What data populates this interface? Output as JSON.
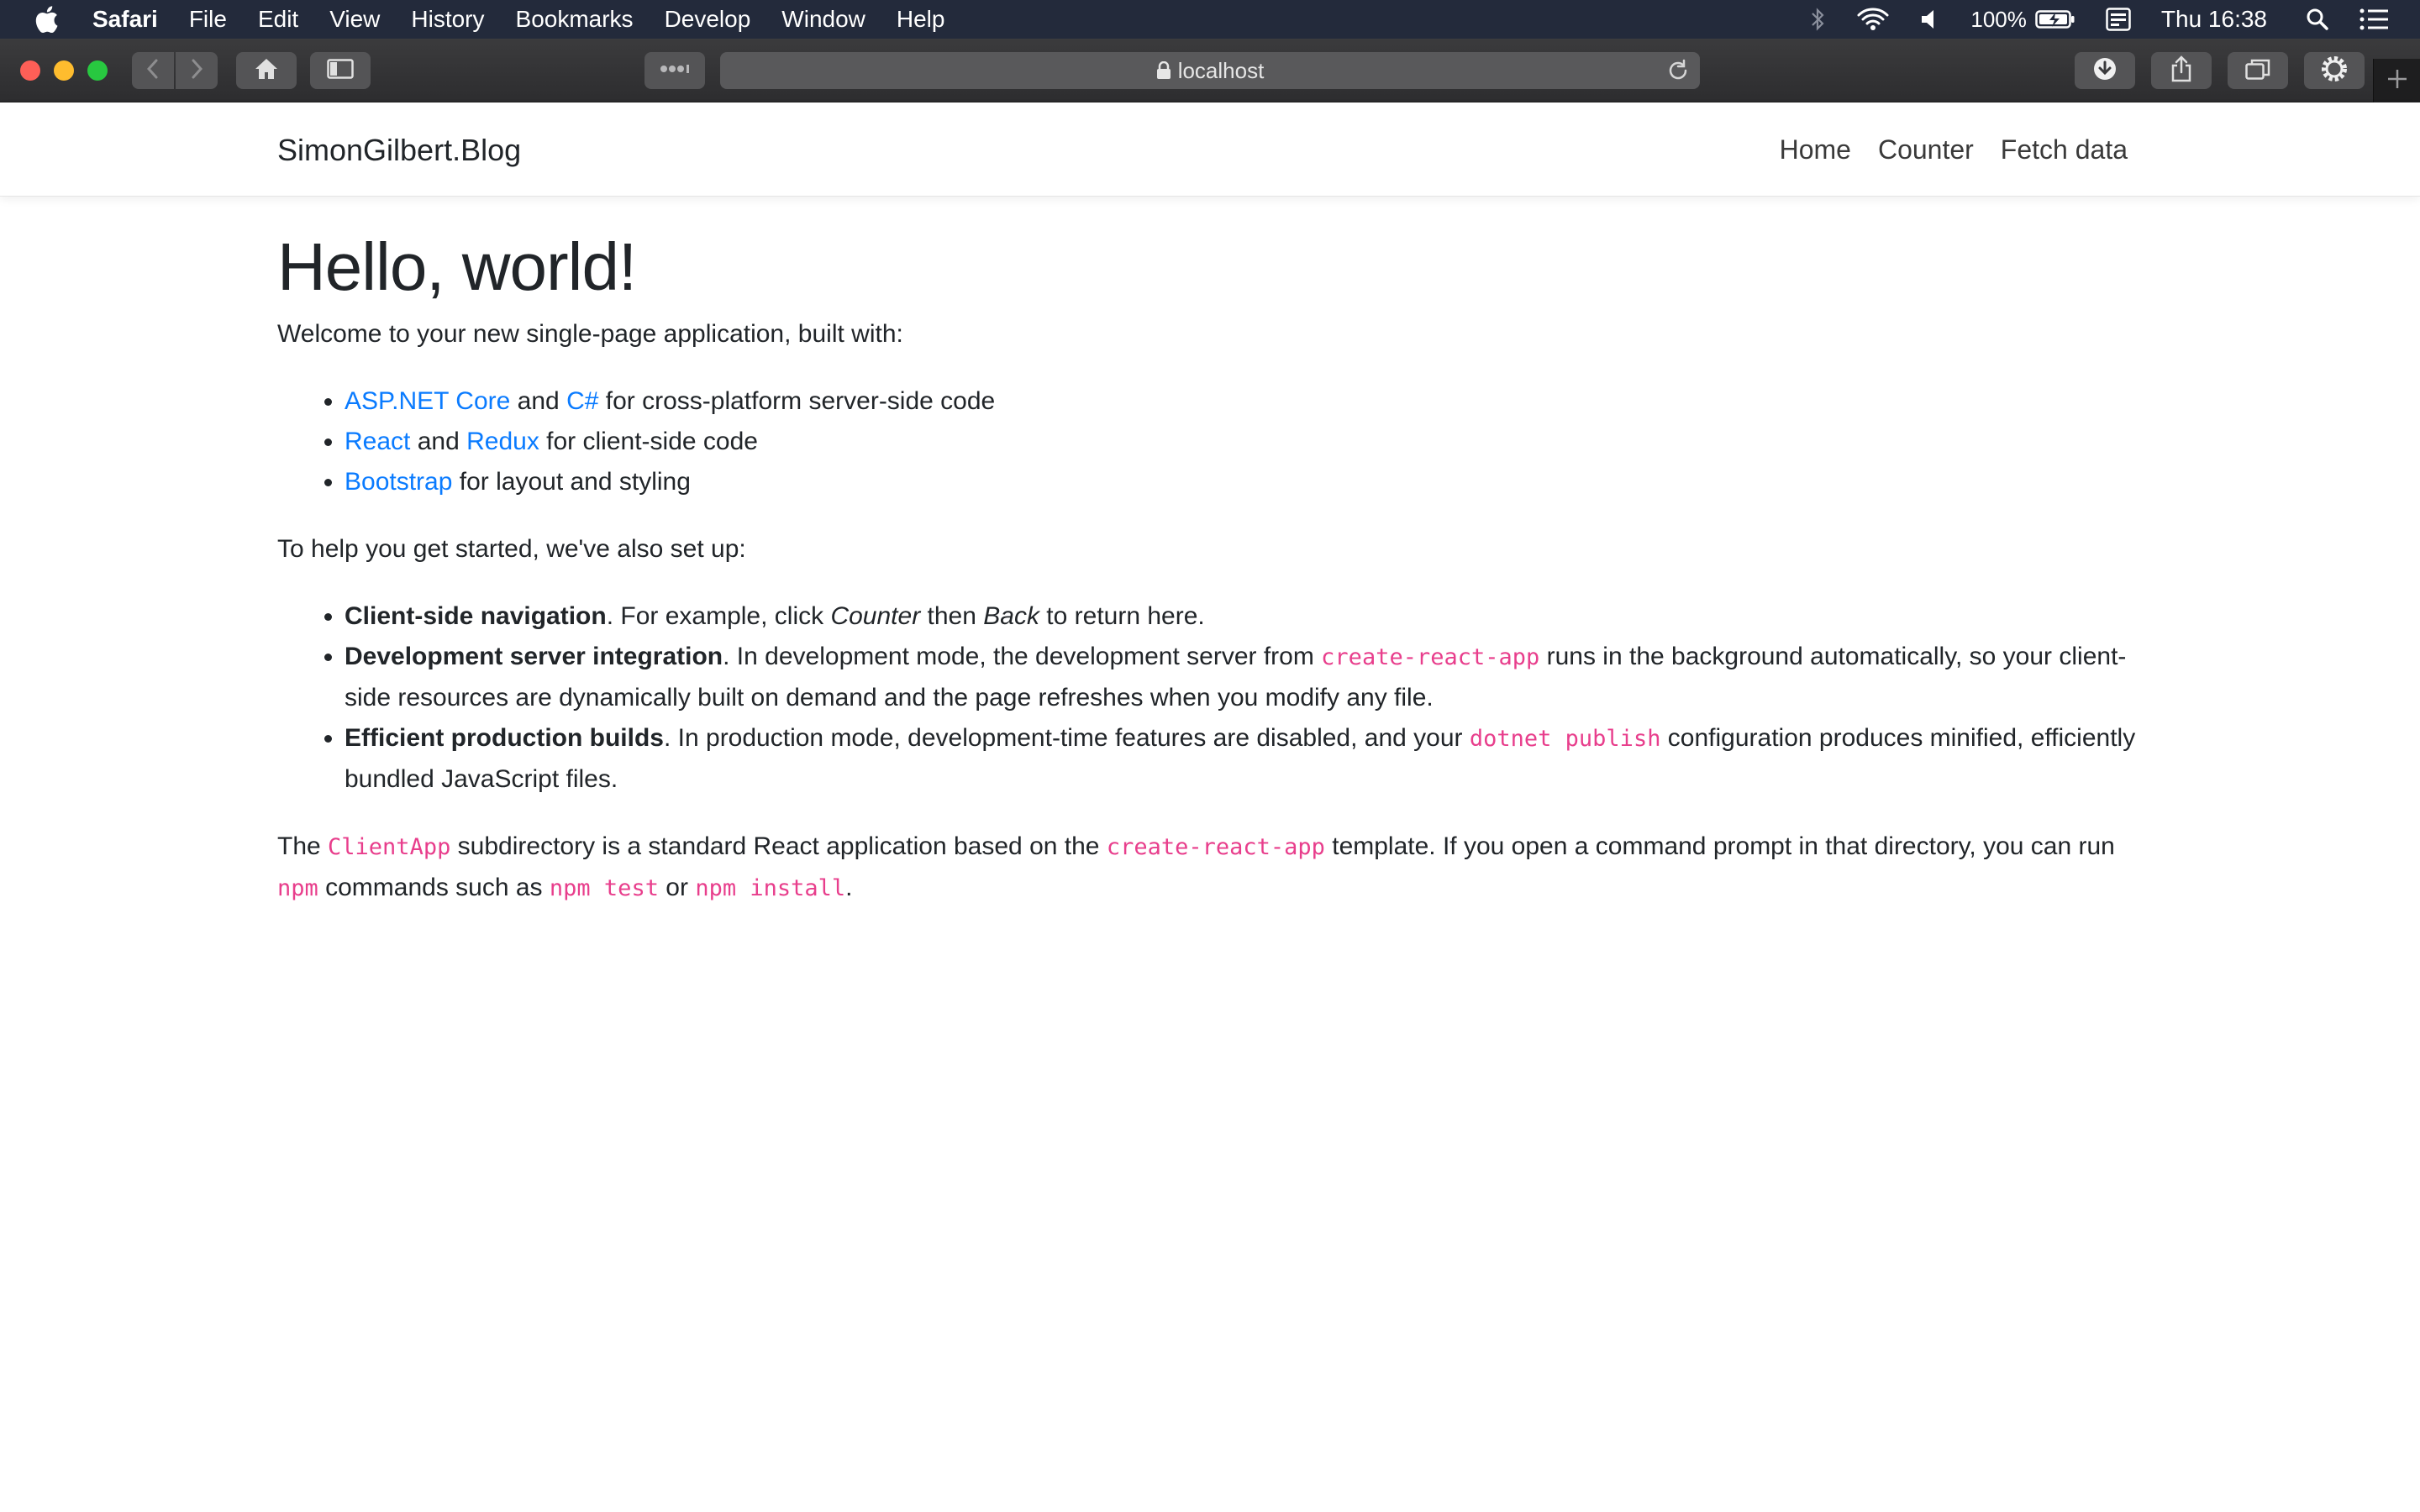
{
  "menubar": {
    "app_name": "Safari",
    "items": [
      "File",
      "Edit",
      "View",
      "History",
      "Bookmarks",
      "Develop",
      "Window",
      "Help"
    ],
    "battery": "100%",
    "clock": "Thu 16:38"
  },
  "toolbar": {
    "address": "localhost"
  },
  "navbar": {
    "brand": "SimonGilbert.Blog",
    "links": [
      "Home",
      "Counter",
      "Fetch data"
    ]
  },
  "page": {
    "heading": "Hello, world!",
    "intro": "Welcome to your new single-page application, built with:",
    "built_with": [
      {
        "link1": "ASP.NET Core",
        "mid": " and ",
        "link2": "C#",
        "tail": " for cross-platform server-side code"
      },
      {
        "link1": "React",
        "mid": " and ",
        "link2": "Redux",
        "tail": " for client-side code"
      },
      {
        "link1": "Bootstrap",
        "tail": " for layout and styling"
      }
    ],
    "setup_intro": "To help you get started, we've also set up:",
    "setup_items": [
      {
        "bold": "Client-side navigation",
        "t1": ". For example, click ",
        "em1": "Counter",
        "t2": " then ",
        "em2": "Back",
        "t3": " to return here."
      },
      {
        "bold": "Development server integration",
        "t1": ". In development mode, the development server from ",
        "code": "create-react-app",
        "t2": " runs in the background automatically, so your client-side resources are dynamically built on demand and the page refreshes when you modify any file."
      },
      {
        "bold": "Efficient production builds",
        "t1": ". In production mode, development-time features are disabled, and your ",
        "code": "dotnet publish",
        "t2": " configuration produces minified, efficiently bundled JavaScript files."
      }
    ],
    "footer": {
      "t1": "The ",
      "c1": "ClientApp",
      "t2": " subdirectory is a standard React application based on the ",
      "c2": "create-react-app",
      "t3": " template. If you open a command prompt in that directory, you can run ",
      "c3": "npm",
      "t4": " commands such as ",
      "c4": "npm test",
      "t5": " or ",
      "c5": "npm install",
      "t6": "."
    }
  },
  "colors": {
    "link": "#0a7bff",
    "code": "#e83e8c",
    "menubar": "#232a3b"
  }
}
